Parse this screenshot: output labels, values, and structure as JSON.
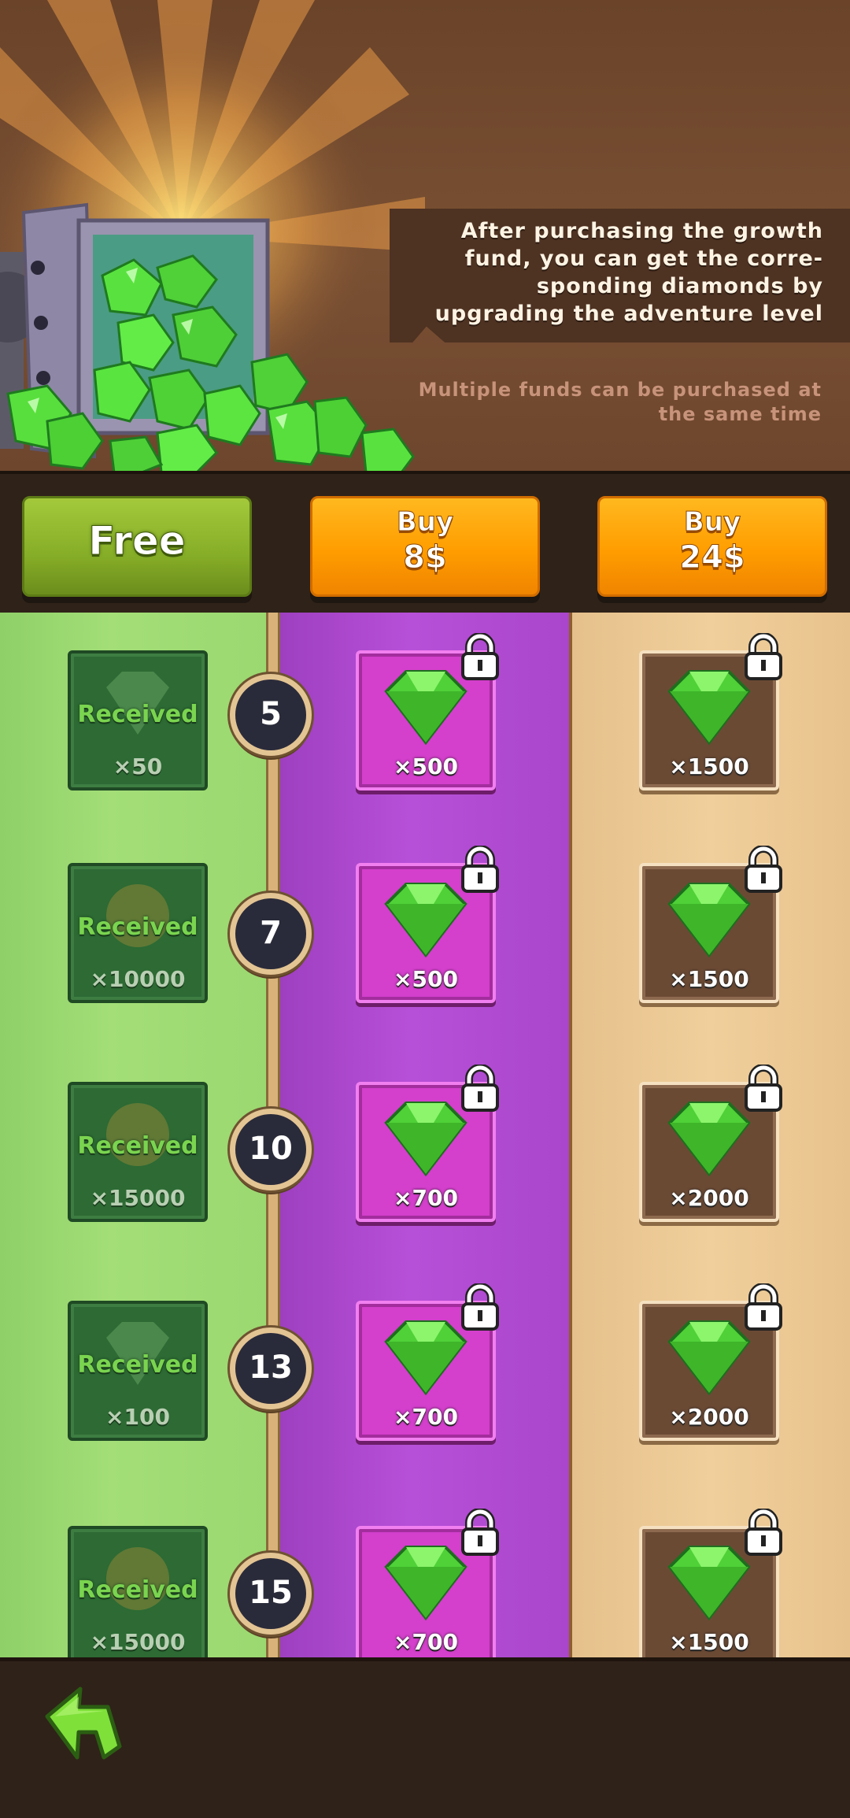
{
  "header": {
    "info": "After purchasing the growth fund, you can get the corre-sponding diamonds by upgrading the adventure level",
    "note": "Multiple funds can be purchased at the same time"
  },
  "buttons": {
    "free": "Free",
    "buy1_label": "Buy",
    "buy1_price": "8$",
    "buy2_label": "Buy",
    "buy2_price": "24$"
  },
  "rows": [
    {
      "level": "5",
      "free_status": "Received",
      "free_amount": "×50",
      "free_reward": "diamond",
      "mid_amount": "×500",
      "gold_amount": "×1500"
    },
    {
      "level": "7",
      "free_status": "Received",
      "free_amount": "×10000",
      "free_reward": "coin",
      "mid_amount": "×500",
      "gold_amount": "×1500"
    },
    {
      "level": "10",
      "free_status": "Received",
      "free_amount": "×15000",
      "free_reward": "coin",
      "mid_amount": "×700",
      "gold_amount": "×2000"
    },
    {
      "level": "13",
      "free_status": "Received",
      "free_amount": "×100",
      "free_reward": "diamond",
      "mid_amount": "×700",
      "gold_amount": "×2000"
    },
    {
      "level": "15",
      "free_status": "Received",
      "free_amount": "×15000",
      "free_reward": "coin",
      "mid_amount": "×700",
      "gold_amount": "×1500"
    }
  ],
  "icons": {
    "gem": "green-gem-icon",
    "lock": "padlock-icon",
    "back": "back-arrow-icon"
  },
  "colors": {
    "free_column": "#a3de77",
    "mid_column": "#b750d8",
    "gold_column": "#f0cf9c",
    "free_button": "#86ad27",
    "buy_button": "#ff9d00"
  }
}
